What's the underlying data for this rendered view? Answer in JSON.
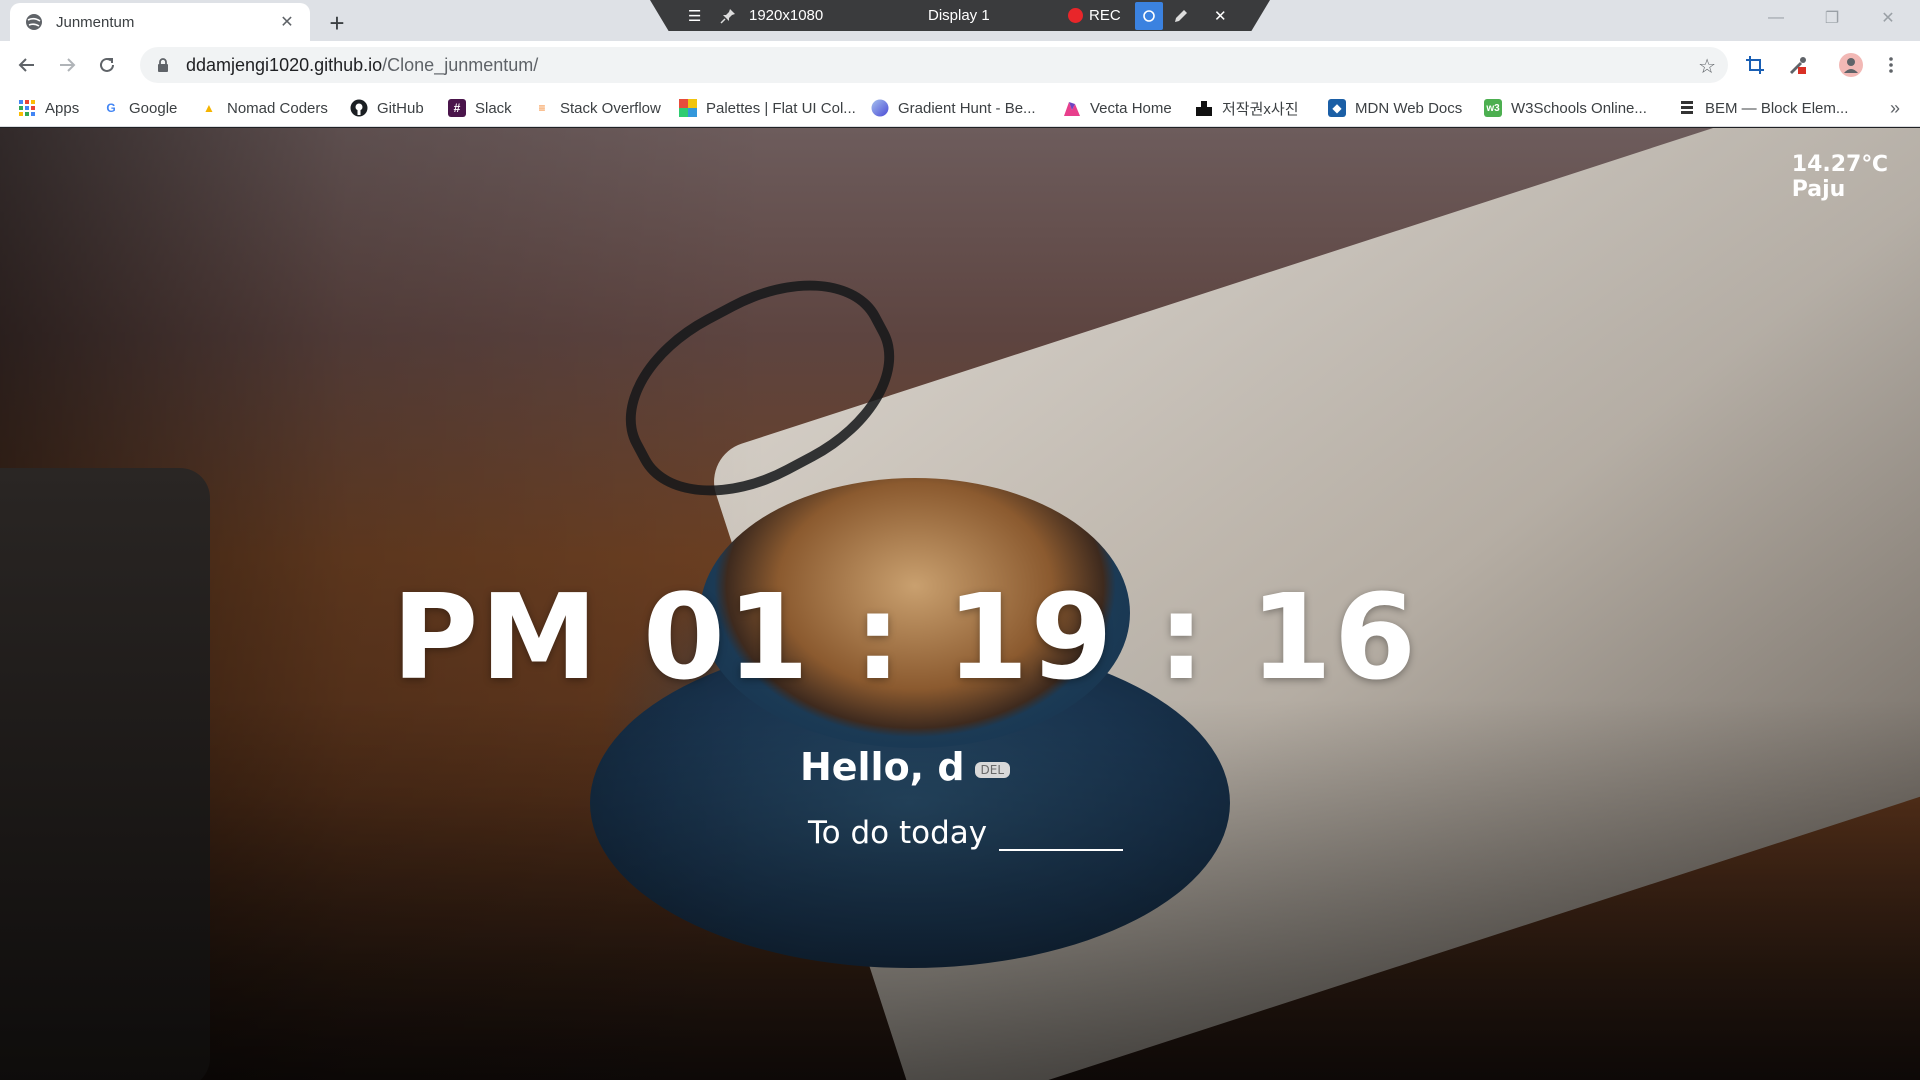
{
  "browser": {
    "tab": {
      "title": "Junmentum",
      "close": "✕"
    },
    "new_tab": "+",
    "url": {
      "host": "ddamjengi1020.github.io",
      "path": "/Clone_junmentum/"
    },
    "window_controls": {
      "minimize": "—",
      "restore": "❐",
      "close": "✕"
    }
  },
  "recorder_bar": {
    "menu": "☰",
    "pin": "📌",
    "resolution": "1920x1080",
    "display": "Display 1",
    "rec_label": "REC",
    "close": "✕"
  },
  "bookmarks": [
    {
      "label": "Apps",
      "icon": "apps-grid-icon"
    },
    {
      "label": "Google",
      "icon": "google-icon"
    },
    {
      "label": "Nomad Coders",
      "icon": "nomad-coders-icon"
    },
    {
      "label": "GitHub",
      "icon": "github-icon"
    },
    {
      "label": "Slack",
      "icon": "slack-icon"
    },
    {
      "label": "Stack Overflow",
      "icon": "stack-overflow-icon"
    },
    {
      "label": "Palettes | Flat UI Col...",
      "icon": "palette-icon"
    },
    {
      "label": "Gradient Hunt - Be...",
      "icon": "gradient-icon"
    },
    {
      "label": "Vecta Home",
      "icon": "vecta-icon"
    },
    {
      "label": "저작권x사진",
      "icon": "photo-icon"
    },
    {
      "label": "MDN Web Docs",
      "icon": "mdn-icon"
    },
    {
      "label": "W3Schools Online...",
      "icon": "w3schools-icon"
    },
    {
      "label": "BEM — Block Elem...",
      "icon": "bem-icon"
    }
  ],
  "bookmarks_more": "»",
  "app": {
    "weather": {
      "temp": "14.27℃",
      "city": "Paju"
    },
    "clock": "PM 01 : 19 : 16",
    "greeting": "Hello, d",
    "del_label": "DEL",
    "todo_label": "To do today",
    "todo_value": ""
  },
  "colors": {
    "accent": "#3b82e0",
    "rec": "#e8262a",
    "text_light": "#ffffff"
  }
}
